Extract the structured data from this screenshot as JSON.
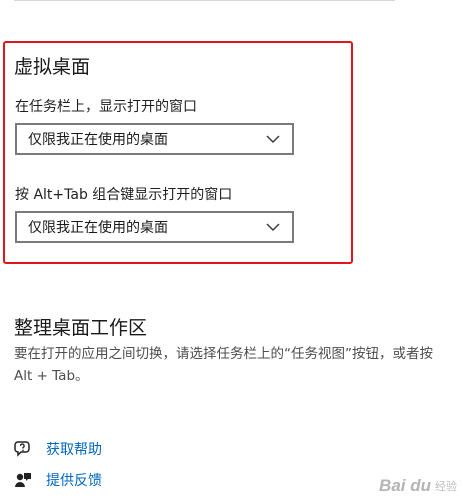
{
  "virtual_desktops": {
    "title": "虚拟桌面",
    "taskbar_label": "在任务栏上，显示打开的窗口",
    "taskbar_selected": "仅限我正在使用的桌面",
    "alttab_label": "按 Alt+Tab 组合键显示打开的窗口",
    "alttab_selected": "仅限我正在使用的桌面"
  },
  "workspace": {
    "title": "整理桌面工作区",
    "description": "要在打开的应用之间切换，请选择任务栏上的“任务视图”按钮，或者按 Alt + Tab。"
  },
  "help": {
    "get_help": "获取帮助",
    "feedback": "提供反馈"
  },
  "watermark": {
    "logo": "Bai du",
    "sub": "经验"
  },
  "colors": {
    "highlight": "#e0161e",
    "link": "#0067c0"
  },
  "icons": {
    "dropdown": "chevron-down-icon",
    "get_help": "help-chat-icon",
    "feedback": "feedback-person-icon"
  }
}
